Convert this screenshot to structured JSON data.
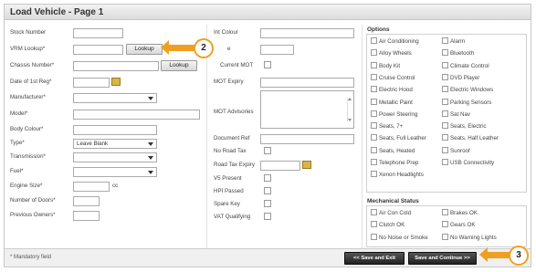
{
  "title": "Load Vehicle - Page 1",
  "left_fields": {
    "stock_number": "Stock Number",
    "vrm_lookup": "VRM Lookup*",
    "lookup_button": "Lookup",
    "chassis_number": "Chassis Number*",
    "date_first_reg": "Date of 1st Reg*",
    "manufacturer": "Manufacturer*",
    "model": "Model*",
    "body_colour": "Body Colour*",
    "type": "Type*",
    "type_value": "Leave Blank",
    "transmission": "Transmission*",
    "fuel": "Fuel*",
    "engine_size": "Engine Size*",
    "engine_unit": "cc",
    "number_of_doors": "Number of Doors*",
    "previous_owners": "Previous Owners*"
  },
  "middle_fields": {
    "int_colour": "Int Colour",
    "mileage": "e",
    "current_mot": "Current MOT",
    "mot_expiry": "MOT Expiry",
    "mot_advisories": "MOT Advisories",
    "document_ref": "Document Ref",
    "no_road_tax": "No Road Tax",
    "road_tax_expiry": "Road Tax Expiry",
    "v5_present": "V5 Present",
    "hpi_passed": "HPI Passed",
    "spare_key": "Spare Key",
    "vat_qualifying": "VAT Qualifying"
  },
  "options": {
    "heading": "Options",
    "items": [
      "Air Conditioning",
      "Alarm",
      "Alloy Wheels",
      "Bluetooth",
      "Body Kit",
      "Climate Control",
      "Cruise Control",
      "DVD Player",
      "Electric Hood",
      "Electric Windows",
      "Metallic Paint",
      "Parking Sensors",
      "Power Steering",
      "Sat Nav",
      "Seats, 7+",
      "Seats, Electric",
      "Seats, Full Leather",
      "Seats, Half Leather",
      "Seats, Heated",
      "Sunroof",
      "Telephone Prep",
      "USB Connectivity",
      "Xenon Headlights"
    ]
  },
  "mechanical": {
    "heading": "Mechanical Status",
    "items": [
      "Air Con Cold",
      "Brakes OK",
      "Clutch OK",
      "Gears OK",
      "No Noise or Smoke",
      "No Warning Lights"
    ]
  },
  "footer": {
    "mandatory": "* Mandatory field",
    "save_exit": "<< Save and Exit",
    "save_continue": "Save and Continue >>"
  },
  "callouts": {
    "two": "2",
    "three": "3"
  },
  "colors": {
    "accent": "#f0a020",
    "button_dark": "#333333"
  }
}
